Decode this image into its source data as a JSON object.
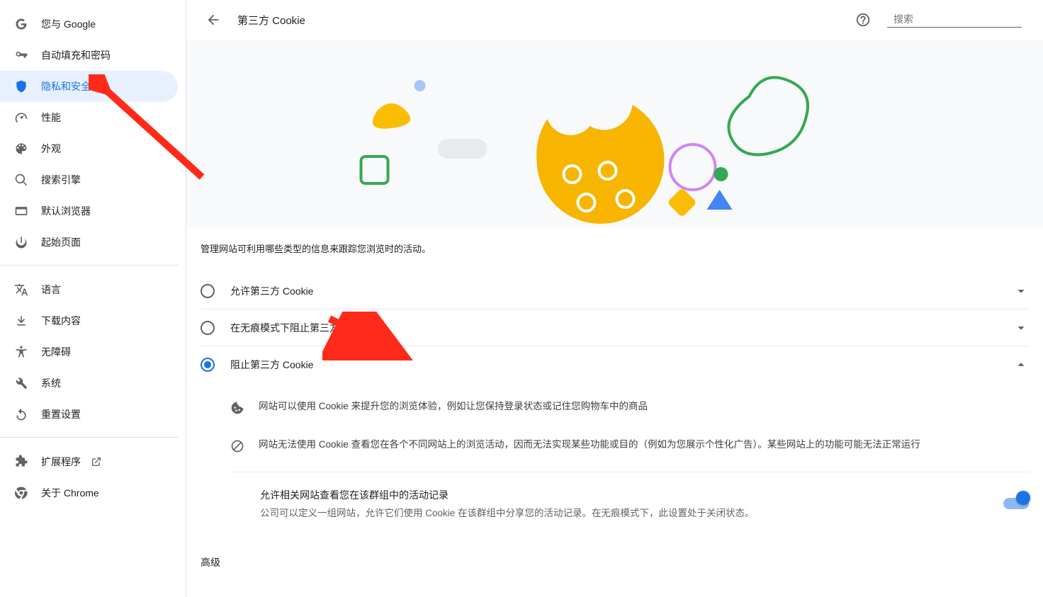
{
  "sidebar": {
    "items": [
      {
        "label": "您与 Google"
      },
      {
        "label": "自动填充和密码"
      },
      {
        "label": "隐私和安全"
      },
      {
        "label": "性能"
      },
      {
        "label": "外观"
      },
      {
        "label": "搜索引擎"
      },
      {
        "label": "默认浏览器"
      },
      {
        "label": "起始页面"
      }
    ],
    "items2": [
      {
        "label": "语言"
      },
      {
        "label": "下载内容"
      },
      {
        "label": "无障碍"
      },
      {
        "label": "系统"
      },
      {
        "label": "重置设置"
      }
    ],
    "items3": [
      {
        "label": "扩展程序"
      },
      {
        "label": "关于 Chrome"
      }
    ]
  },
  "header": {
    "title": "第三方 Cookie",
    "search_placeholder": "搜索"
  },
  "main": {
    "description": "管理网站可利用哪些类型的信息来跟踪您浏览时的活动。",
    "options": [
      {
        "label": "允许第三方 Cookie",
        "checked": false,
        "expanded": false
      },
      {
        "label": "在无痕模式下阻止第三方 Cookie",
        "checked": false,
        "expanded": false
      },
      {
        "label": "阻止第三方 Cookie",
        "checked": true,
        "expanded": true
      }
    ],
    "details": [
      {
        "text": "网站可以使用 Cookie 来提升您的浏览体验，例如让您保持登录状态或记住您购物车中的商品"
      },
      {
        "text": "网站无法使用 Cookie 查看您在各个不同网站上的浏览活动，因而无法实现某些功能或目的（例如为您展示个性化广告）。某些网站上的功能可能无法正常运行"
      }
    ],
    "toggle": {
      "title": "允许相关网站查看您在该群组中的活动记录",
      "desc": "公司可以定义一组网站，允许它们使用 Cookie 在该群组中分享您的活动记录。在无痕模式下，此设置处于关闭状态。",
      "on": true
    },
    "advanced": "高级"
  }
}
